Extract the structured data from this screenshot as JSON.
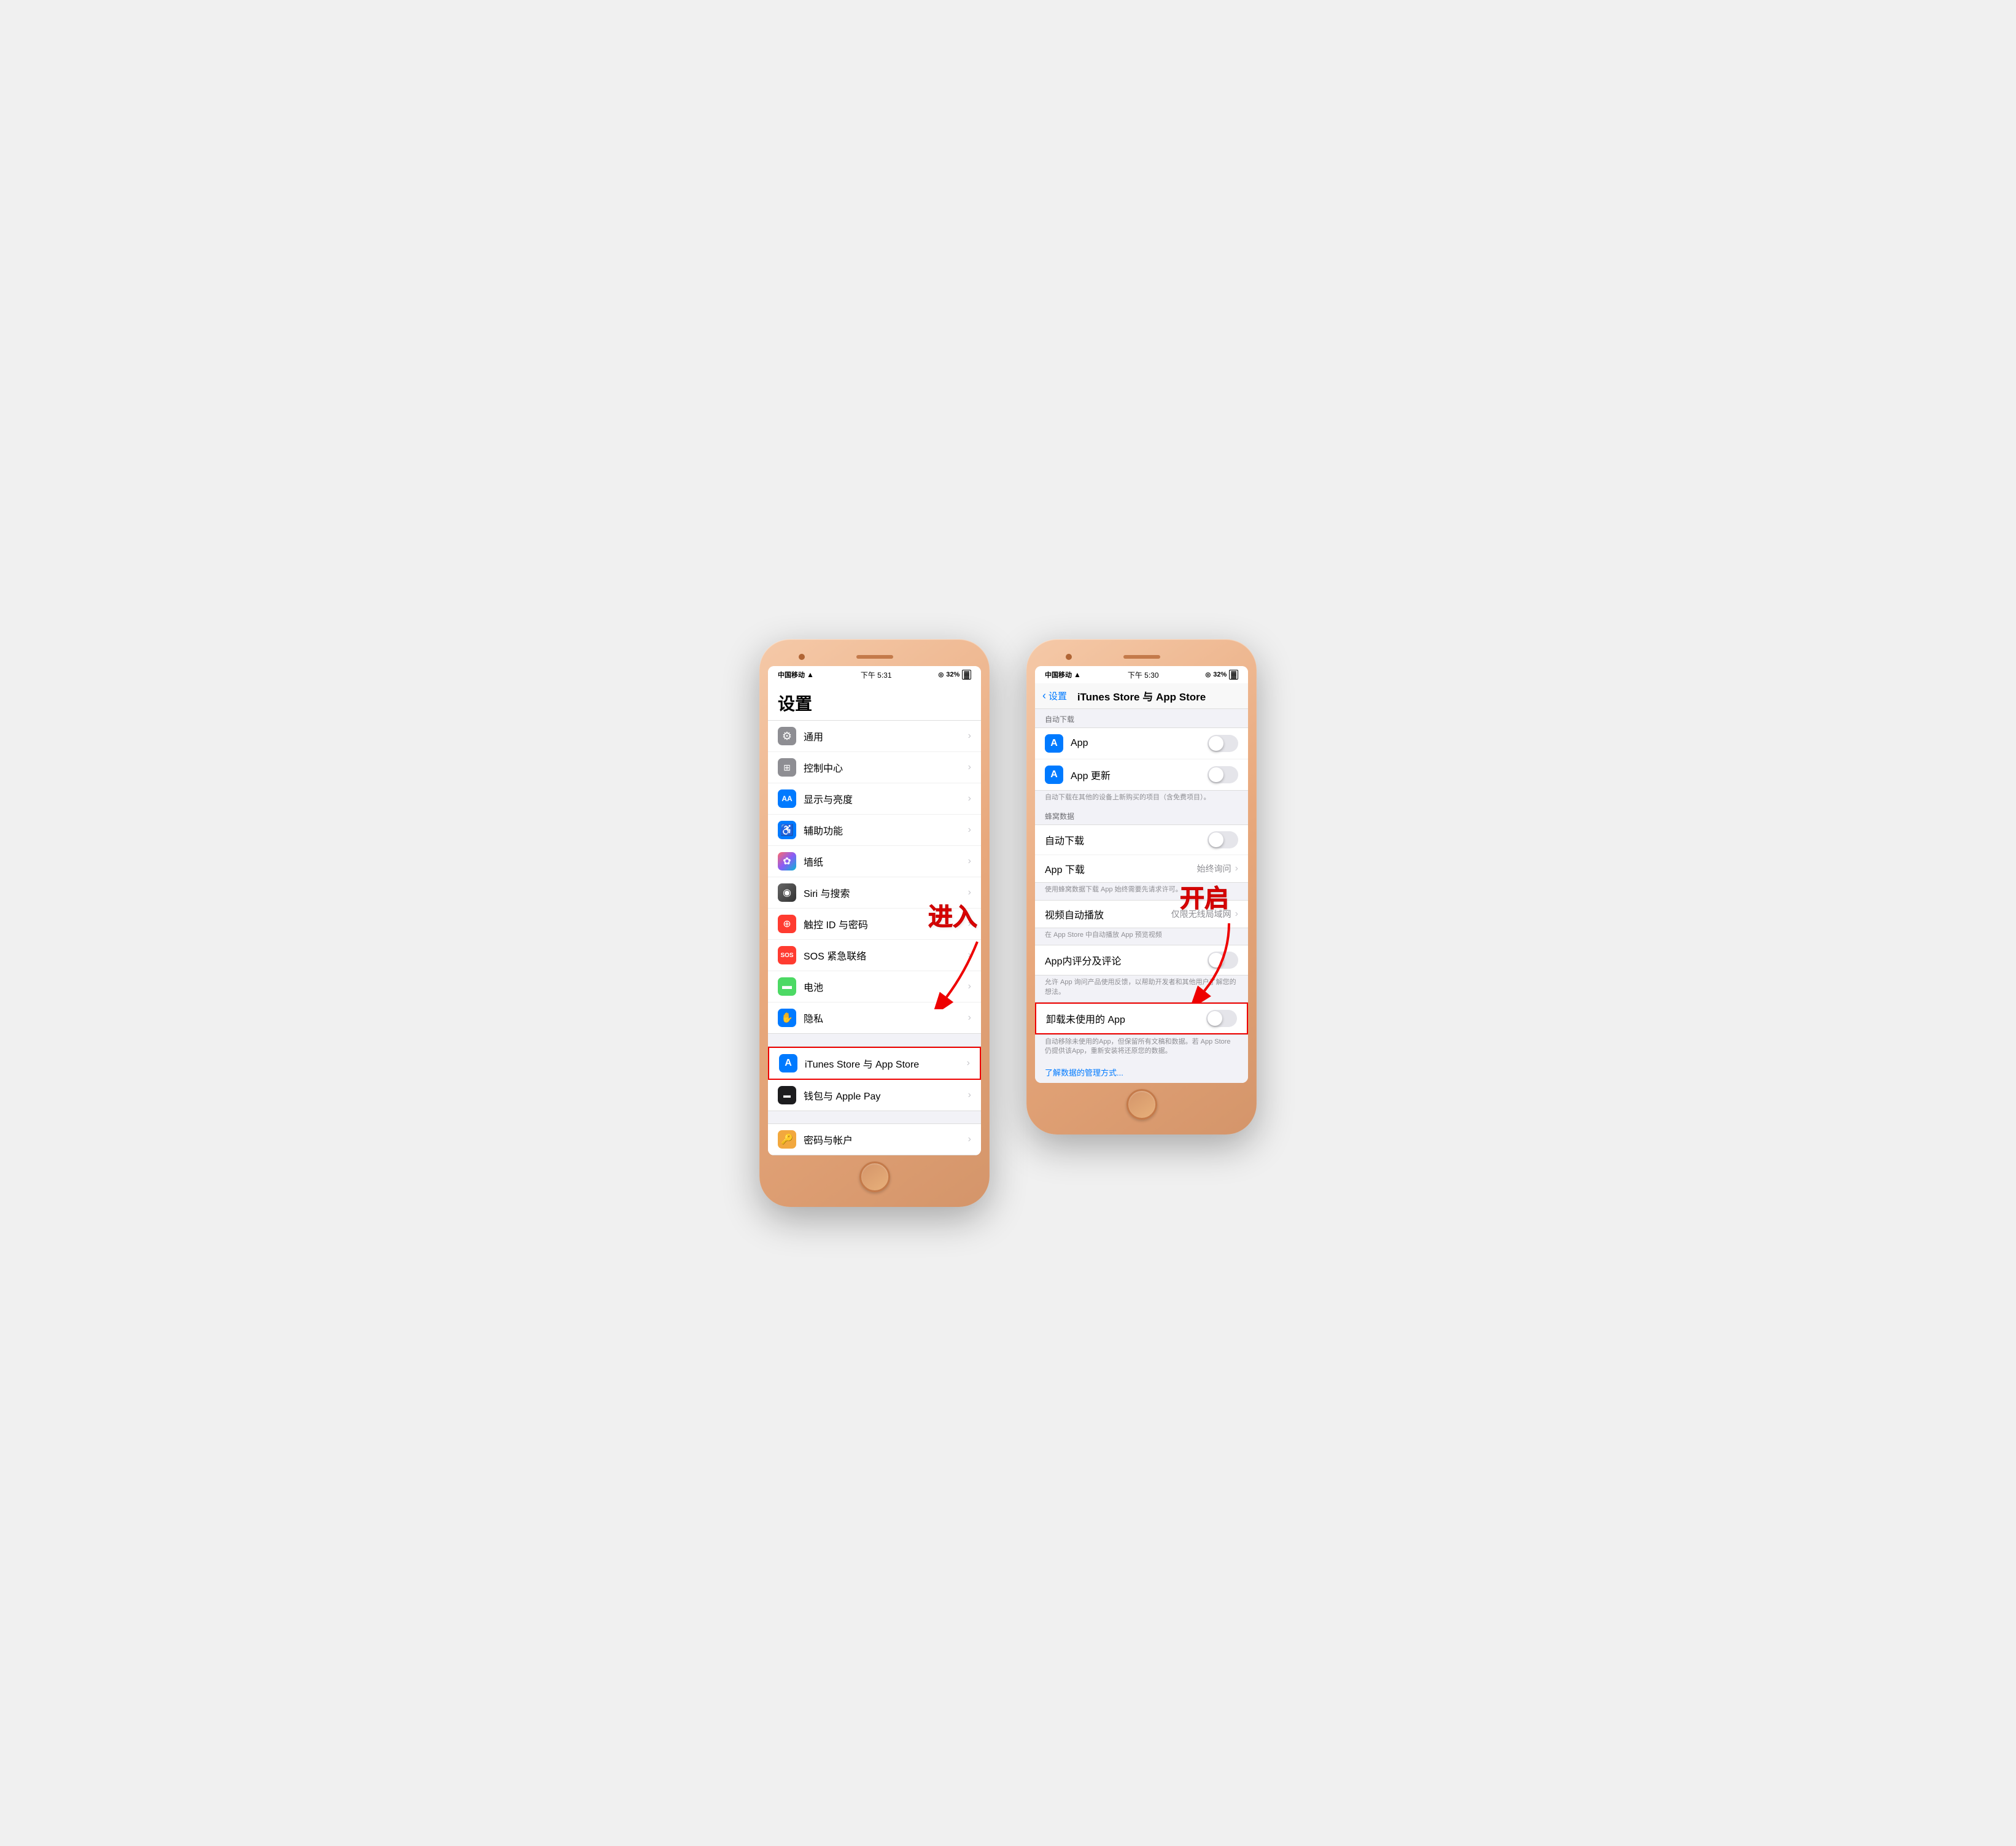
{
  "phone1": {
    "status": {
      "carrier": "中国移动",
      "wifi": "wifi",
      "time": "下午 5:31",
      "battery_icon": "⊕",
      "battery_text": "32%"
    },
    "title": "设置",
    "items": [
      {
        "id": "general",
        "icon_bg": "#8e8e93",
        "icon": "⚙",
        "label": "通用"
      },
      {
        "id": "control",
        "icon_bg": "#8e8e93",
        "icon": "☰",
        "label": "控制中心"
      },
      {
        "id": "display",
        "icon_bg": "#007aff",
        "icon": "AA",
        "label": "显示与亮度"
      },
      {
        "id": "accessibility",
        "icon_bg": "#007aff",
        "icon": "♿",
        "label": "辅助功能"
      },
      {
        "id": "wallpaper",
        "icon_bg": "#ff9500",
        "icon": "❊",
        "label": "墙纸"
      },
      {
        "id": "siri",
        "icon_bg": "#000",
        "icon": "◉",
        "label": "Siri 与搜索"
      },
      {
        "id": "touchid",
        "icon_bg": "#ff3b30",
        "icon": "⊕",
        "label": "触控 ID 与密码"
      },
      {
        "id": "sos",
        "icon_bg": "#ff3b30",
        "icon": "SOS",
        "label": "SOS 紧急联络"
      },
      {
        "id": "battery",
        "icon_bg": "#4cd964",
        "icon": "▬",
        "label": "电池"
      },
      {
        "id": "privacy",
        "icon_bg": "#007aff",
        "icon": "✋",
        "label": "隐私"
      }
    ],
    "highlighted_items": [
      {
        "id": "itunes",
        "icon_bg": "#007aff",
        "icon": "A",
        "label": "iTunes Store 与 App Store",
        "highlighted": true
      },
      {
        "id": "wallet",
        "icon_bg": "#000",
        "icon": "▬",
        "label": "钱包与 Apple Pay"
      }
    ],
    "bottom_items": [
      {
        "id": "passwords",
        "icon_bg": "#f2a83e",
        "icon": "🔑",
        "label": "密码与帐户"
      }
    ],
    "annotation": {
      "text": "进入",
      "arrow_label": "arrow-down-left"
    }
  },
  "phone2": {
    "status": {
      "carrier": "中国移动",
      "wifi": "wifi",
      "time": "下午 5:30",
      "battery_text": "32%"
    },
    "nav_back": "设置",
    "nav_title": "iTunes Store 与 App Store",
    "section1_header": "自动下载",
    "auto_download_items": [
      {
        "id": "app",
        "icon_bg": "#007aff",
        "icon": "A",
        "label": "App",
        "toggle": "off"
      },
      {
        "id": "app_update",
        "icon_bg": "#007aff",
        "icon": "A",
        "label": "App 更新",
        "toggle": "off"
      }
    ],
    "auto_download_note": "自动下载在其他的设备上新购买的项目（含免费项目）。",
    "section2_header": "蜂窝数据",
    "cellular_items": [
      {
        "id": "cellular_auto",
        "label": "自动下载",
        "toggle": "off"
      },
      {
        "id": "app_download",
        "label": "App 下载",
        "value": "始终询问"
      }
    ],
    "cellular_note": "使用蜂窝数据下载 App 始终需要先请求许可。",
    "video_label": "视频自动播放",
    "video_value": "仅限无线局域网",
    "video_note": "在 App Store 中自动播放 App 预览视频",
    "rating_label": "App内评分及评论",
    "rating_toggle": "off",
    "rating_note": "允许 App 询问产品使用反馈，以帮助开发者和其他用户了解您的想法。",
    "unload_label": "卸载未使用的 App",
    "unload_toggle": "off",
    "unload_note": "自动移除未使用的App，但保留所有文稿和数据。若 App Store 仍提供该App，重新安装将还原您的数据。",
    "link_text": "了解数据的管理方式...",
    "annotation": {
      "text": "开启",
      "arrow_label": "arrow-down-right"
    }
  },
  "icons": {
    "gear": "⚙",
    "control_center": "≡",
    "display": "Aa",
    "accessibility": "⊕",
    "wallpaper": "✿",
    "siri": "◉",
    "touchid": "◉",
    "sos": "SOS",
    "battery": "▬",
    "privacy": "✋",
    "itunes": "A",
    "wallet": "▬",
    "password": "🔑",
    "chevron": "›",
    "wifi_signal": "▲",
    "battery_indicator": "▓"
  }
}
